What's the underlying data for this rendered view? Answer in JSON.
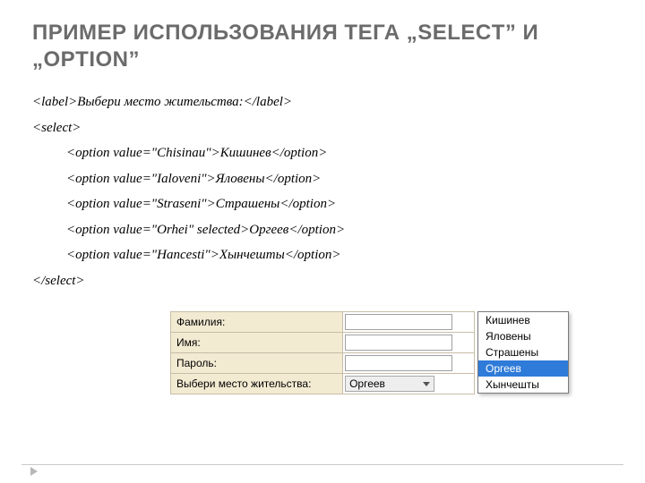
{
  "title": "ПРИМЕР ИСПОЛЬЗОВАНИЯ ТЕГА „SELECT” И „OPTION”",
  "code": {
    "l1": "<label>Выбери место жительства:</label>",
    "l2": "<select>",
    "l3": "<option value=\"Chisinau\">Кишинев</option>",
    "l4": "<option value=\"Ialoveni\">Яловены</option>",
    "l5": "<option value=\"Straseni\">Страшены</option>",
    "l6": "<option value=\"Orhei\" selected>Оргеев</option>",
    "l7": "<option value=\"Hancesti\">Хынчешты</option>",
    "l8": "</select>"
  },
  "form": {
    "surname_label": "Фамилия:",
    "name_label": "Имя:",
    "password_label": "Пароль:",
    "city_label": "Выбери место жительства:",
    "selected": "Оргеев"
  },
  "options": {
    "o1": "Кишинев",
    "o2": "Яловены",
    "o3": "Страшены",
    "o4": "Оргеев",
    "o5": "Хынчешты"
  }
}
